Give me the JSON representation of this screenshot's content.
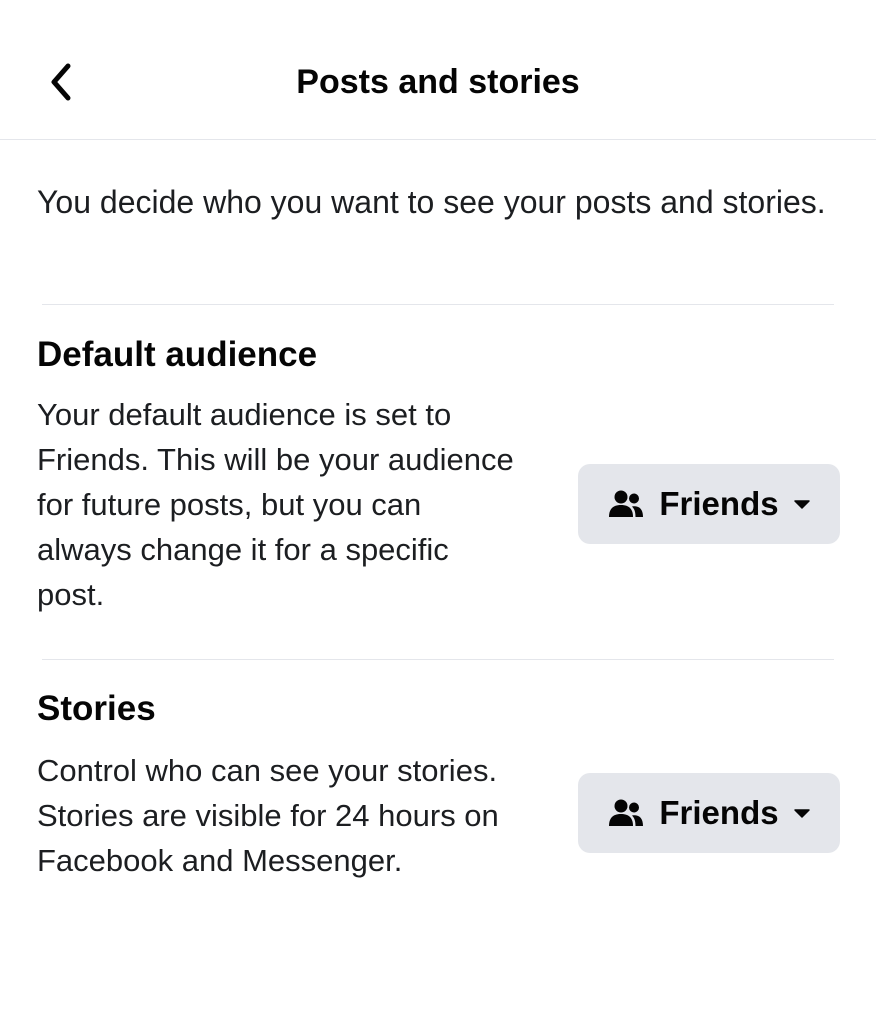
{
  "header": {
    "title": "Posts and stories",
    "back_icon": "chevron-left-icon"
  },
  "intro": {
    "text": "You decide who you want to see your posts and stories."
  },
  "sections": [
    {
      "title": "Default audience",
      "description": "Your default audience is set to Friends. This will be your audience for future posts, but you can always change it for a specific post.",
      "selector": {
        "icon": "friends-icon",
        "label": "Friends",
        "dropdown_icon": "caret-down-icon"
      }
    },
    {
      "title": "Stories",
      "description": "Control who can see your stories. Stories are visible for 24 hours on Facebook and Messenger.",
      "selector": {
        "icon": "friends-icon",
        "label": "Friends",
        "dropdown_icon": "caret-down-icon"
      }
    }
  ],
  "colors": {
    "background": "#ffffff",
    "text": "#050505",
    "button_background": "#e4e6eb",
    "divider": "#e4e6eb"
  }
}
